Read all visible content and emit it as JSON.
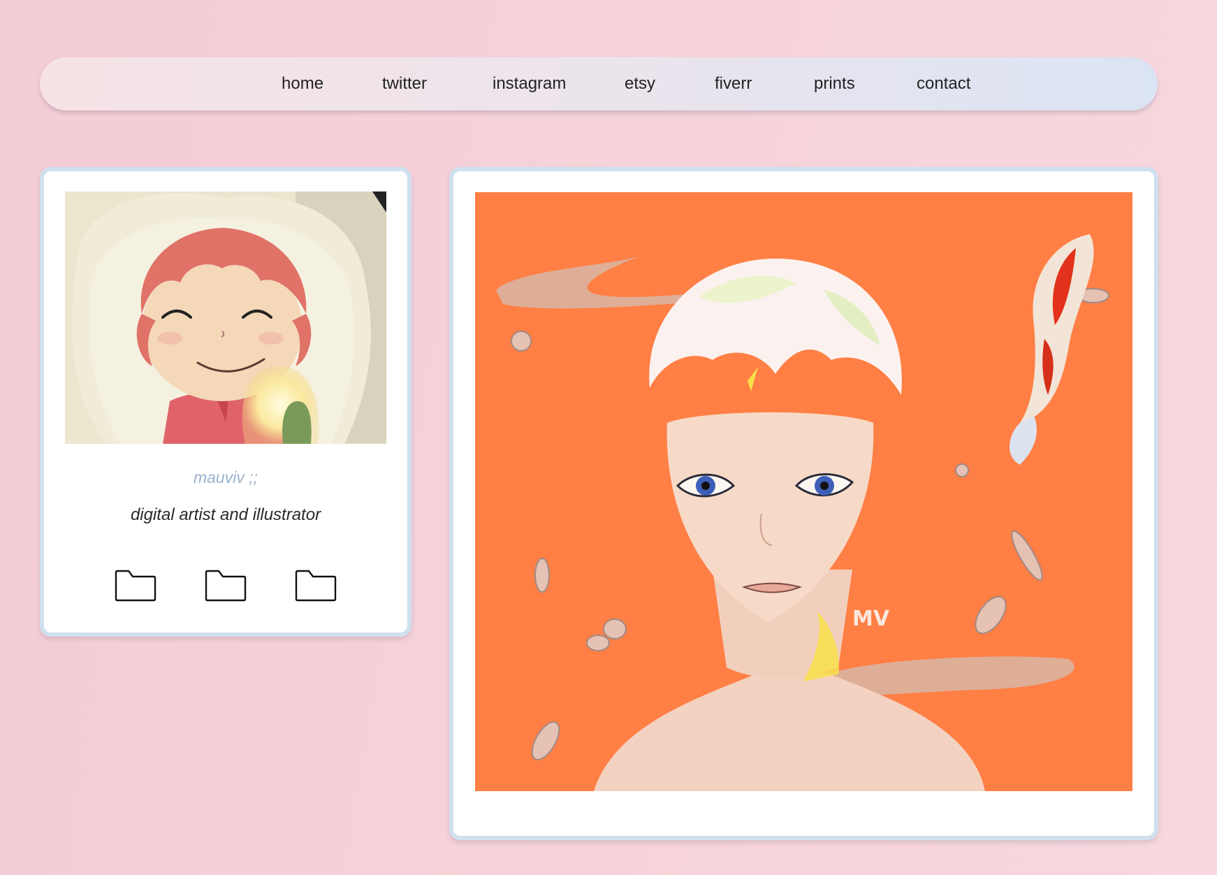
{
  "nav": {
    "items": [
      {
        "label": "home"
      },
      {
        "label": "twitter"
      },
      {
        "label": "instagram"
      },
      {
        "label": "etsy"
      },
      {
        "label": "fiverr"
      },
      {
        "label": "prints"
      },
      {
        "label": "contact"
      }
    ]
  },
  "profile": {
    "username": "mauviv ;;",
    "tagline": "digital artist and illustrator",
    "avatar_icon": "smiling-girl-avatar",
    "folders": [
      {
        "icon": "folder-icon"
      },
      {
        "icon": "folder-icon"
      },
      {
        "icon": "folder-icon"
      }
    ]
  },
  "artwork": {
    "signature": "MV",
    "colors": {
      "background": "#ff7f45",
      "accent": "#cfe0ef"
    }
  }
}
